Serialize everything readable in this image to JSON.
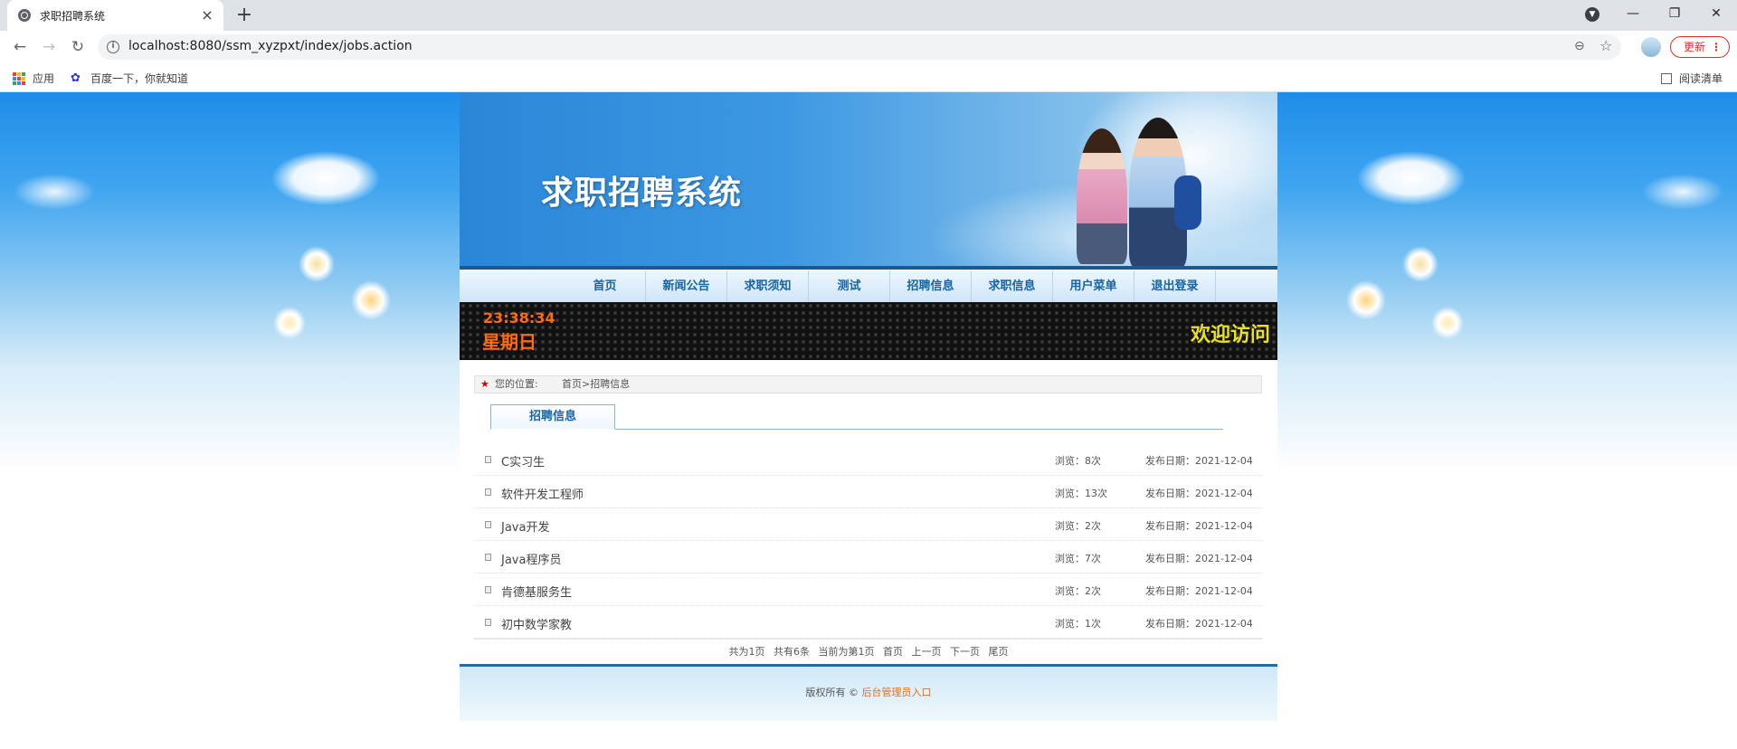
{
  "browser": {
    "tab_title": "求职招聘系统",
    "url": "localhost:8080/ssm_xyzpxt/index/jobs.action",
    "update_label": "更新",
    "bookmarks": [
      {
        "label": "应用",
        "icon": "apps-icon"
      },
      {
        "label": "百度一下，你就知道",
        "icon": "baidu-icon"
      }
    ],
    "reading_list_label": "阅读清单"
  },
  "banner": {
    "title": "求职招聘系统"
  },
  "nav": {
    "items": [
      "首页",
      "新闻公告",
      "求职须知",
      "测试",
      "招聘信息",
      "求职信息",
      "用户菜单",
      "退出登录"
    ]
  },
  "ledbar": {
    "time": "23:38:34",
    "weekday": "星期日",
    "welcome": "欢迎访问"
  },
  "breadcrumb": {
    "label": "您的位置:",
    "path": "首页>招聘信息"
  },
  "section_tab": {
    "label": "招聘信息"
  },
  "jobs": [
    {
      "name": "C实习生",
      "views": "浏览：8次",
      "date": "发布日期：2021-12-04"
    },
    {
      "name": "软件开发工程师",
      "views": "浏览：13次",
      "date": "发布日期：2021-12-04"
    },
    {
      "name": "Java开发",
      "views": "浏览：2次",
      "date": "发布日期：2021-12-04"
    },
    {
      "name": "Java程序员",
      "views": "浏览：7次",
      "date": "发布日期：2021-12-04"
    },
    {
      "name": "肯德基服务生",
      "views": "浏览：2次",
      "date": "发布日期：2021-12-04"
    },
    {
      "name": "初中数学家教",
      "views": "浏览：1次",
      "date": "发布日期：2021-12-04"
    }
  ],
  "pager": {
    "total_pages": "共为1页",
    "total_items": "共有6条",
    "current": "当前为第1页",
    "first": "首页",
    "prev": "上一页",
    "next": "下一页",
    "last": "尾页"
  },
  "footer": {
    "copyright": "版权所有 ©",
    "admin_link": "后台管理员入口"
  },
  "colors": {
    "accent_orange": "#ff6a13",
    "nav_text": "#1565a6",
    "welcome_yellow": "#e8e020"
  }
}
